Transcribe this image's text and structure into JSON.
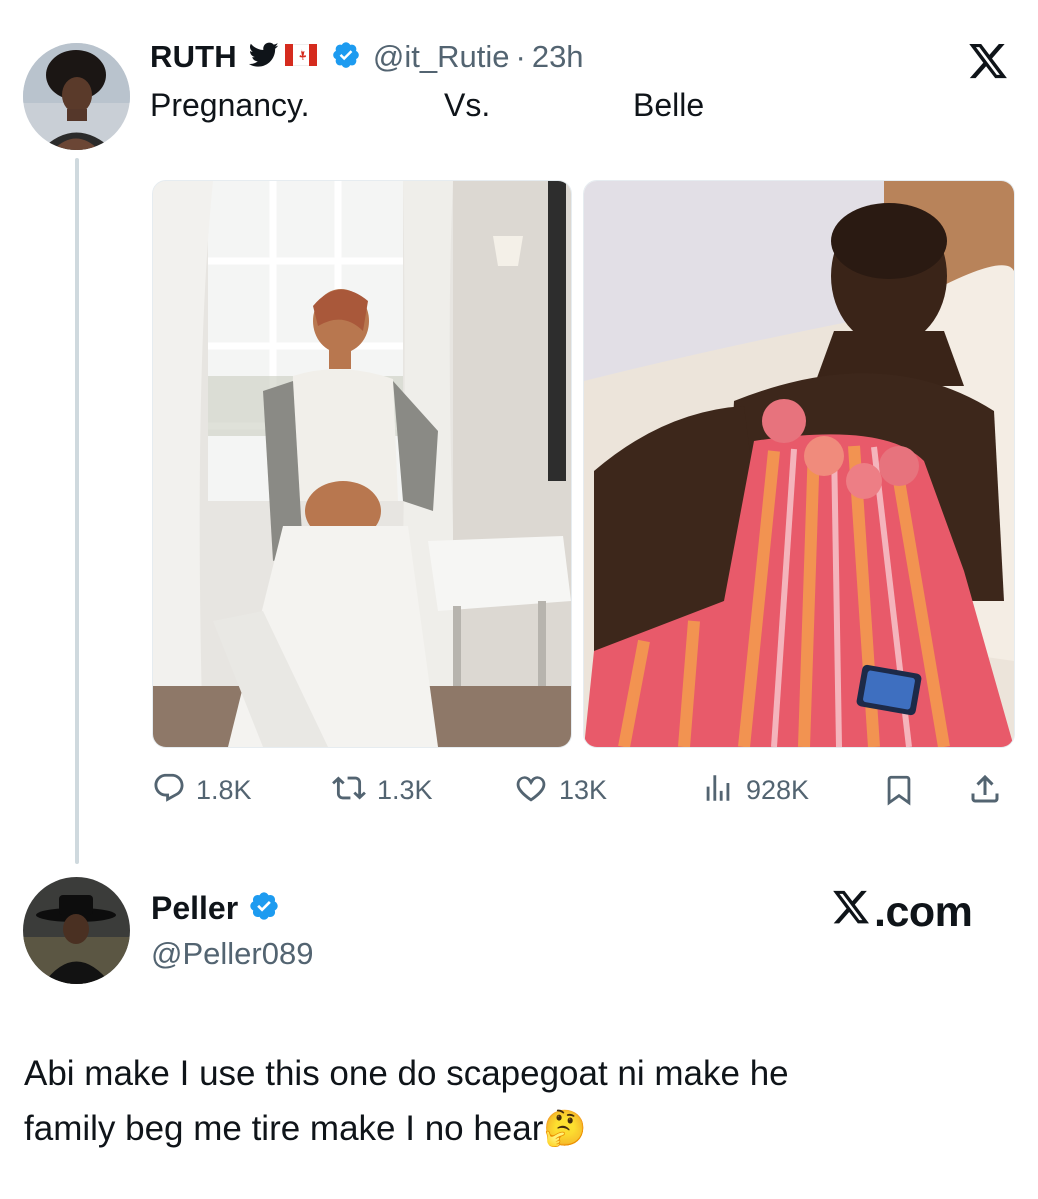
{
  "tweet": {
    "author_name": "RUTH",
    "author_flag_icons": [
      "bird-icon",
      "canada-flag-icon"
    ],
    "author_handle": "@it_Rutie",
    "separator": "·",
    "time": "23h",
    "text_parts": [
      "Pregnancy.",
      "Vs.",
      "Belle"
    ],
    "close_icon": "x-logo-icon",
    "media": [
      {
        "name": "pregnancy-photo",
        "description_icon": "photo"
      },
      {
        "name": "belle-photo",
        "description_icon": "photo"
      }
    ],
    "actions": {
      "replies": "1.8K",
      "retweets": "1.3K",
      "likes": "13K",
      "views": "928K"
    }
  },
  "reply": {
    "author_name": "Peller",
    "author_handle": "@Peller089",
    "brand": "X.com",
    "text_line1": "Abi make I use this one do scapegoat ni make he",
    "text_line2": "family beg me tire make I no hear",
    "emoji": "🤔"
  },
  "colors": {
    "verified_blue": "#1d9bf0",
    "muted": "#536471",
    "thread_line": "#cfd9de"
  }
}
